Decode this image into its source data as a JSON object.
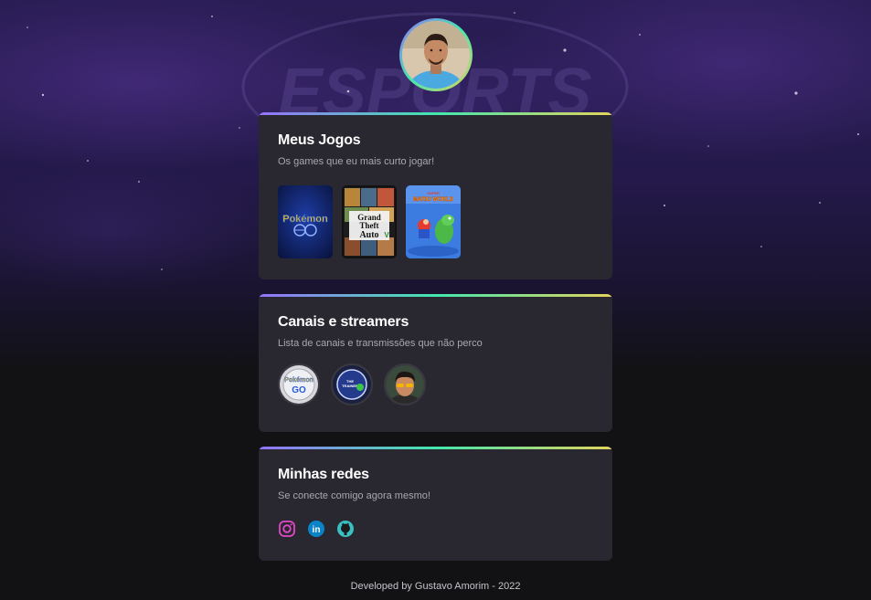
{
  "profile": {
    "avatar_icon": "user-photo"
  },
  "games_card": {
    "title": "Meus Jogos",
    "subtitle": "Os games que eu mais curto jogar!",
    "games": [
      {
        "name": "Pokémon GO",
        "icon": "pokemon-go-cover"
      },
      {
        "name": "Grand Theft Auto V",
        "icon": "gta-v-cover"
      },
      {
        "name": "Super Mario World",
        "icon": "super-mario-world-cover"
      }
    ]
  },
  "streamers_card": {
    "title": "Canais e streamers",
    "subtitle": "Lista de canais e transmissões que não perco",
    "streamers": [
      {
        "icon": "pokemon-go-channel-avatar"
      },
      {
        "icon": "trainer-club-channel-avatar"
      },
      {
        "icon": "streamer-avatar"
      }
    ]
  },
  "social_card": {
    "title": "Minhas redes",
    "subtitle": "Se conecte comigo agora mesmo!",
    "links": [
      {
        "name": "Instagram",
        "icon": "instagram-icon"
      },
      {
        "name": "LinkedIn",
        "icon": "linkedin-icon"
      },
      {
        "name": "GitHub",
        "icon": "github-icon"
      }
    ]
  },
  "footer": {
    "text": "Developed by Gustavo Amorim - 2022"
  },
  "colors": {
    "background": "#121214",
    "card": "#29272f",
    "gradient": [
      "#9572fc",
      "#43e7ad",
      "#e2d45c"
    ]
  }
}
